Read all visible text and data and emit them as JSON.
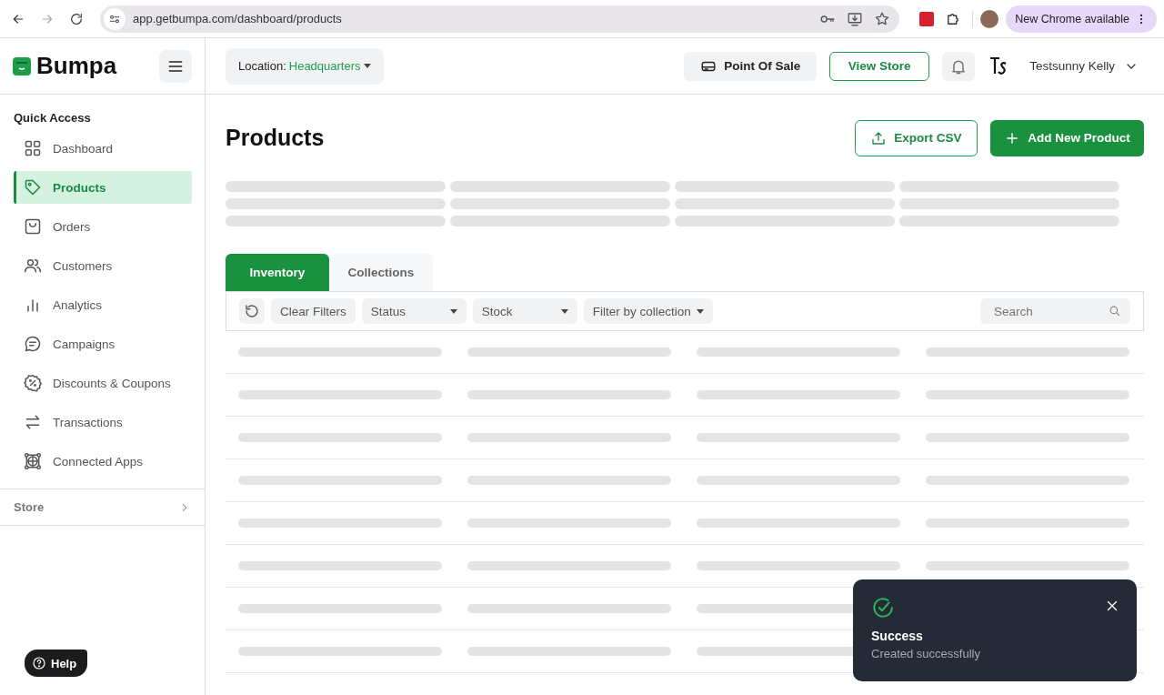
{
  "browser": {
    "url": "app.getbumpa.com/dashboard/products",
    "update_badge": "New Chrome available"
  },
  "header": {
    "brand": "Bumpa",
    "location": {
      "label": "Location:",
      "value": "Headquarters"
    },
    "point_of_sale": "Point Of Sale",
    "view_store": "View Store",
    "user_name": "Testsunny Kelly"
  },
  "sidebar": {
    "section": "Quick Access",
    "items": [
      {
        "label": "Dashboard",
        "kind": "grid",
        "selected": false
      },
      {
        "label": "Products",
        "kind": "tag",
        "selected": true
      },
      {
        "label": "Orders",
        "kind": "bag",
        "selected": false
      },
      {
        "label": "Customers",
        "kind": "users",
        "selected": false
      },
      {
        "label": "Analytics",
        "kind": "bars",
        "selected": false
      },
      {
        "label": "Campaigns",
        "kind": "chat",
        "selected": false
      },
      {
        "label": "Discounts & Coupons",
        "kind": "discount",
        "selected": false
      },
      {
        "label": "Transactions",
        "kind": "swap",
        "selected": false
      },
      {
        "label": "Connected Apps",
        "kind": "network",
        "selected": false
      }
    ],
    "store": "Store",
    "help": "Help"
  },
  "page": {
    "title": "Products",
    "export": "Export CSV",
    "add": "Add New Product"
  },
  "tabs": [
    {
      "label": "Inventory",
      "selected": true
    },
    {
      "label": "Collections",
      "selected": false
    }
  ],
  "filters": {
    "clear": "Clear Filters",
    "status": "Status",
    "stock": "Stock",
    "collection": "Filter by collection",
    "search_placeholder": "Search"
  },
  "toast": {
    "title": "Success",
    "message": "Created successfully"
  }
}
